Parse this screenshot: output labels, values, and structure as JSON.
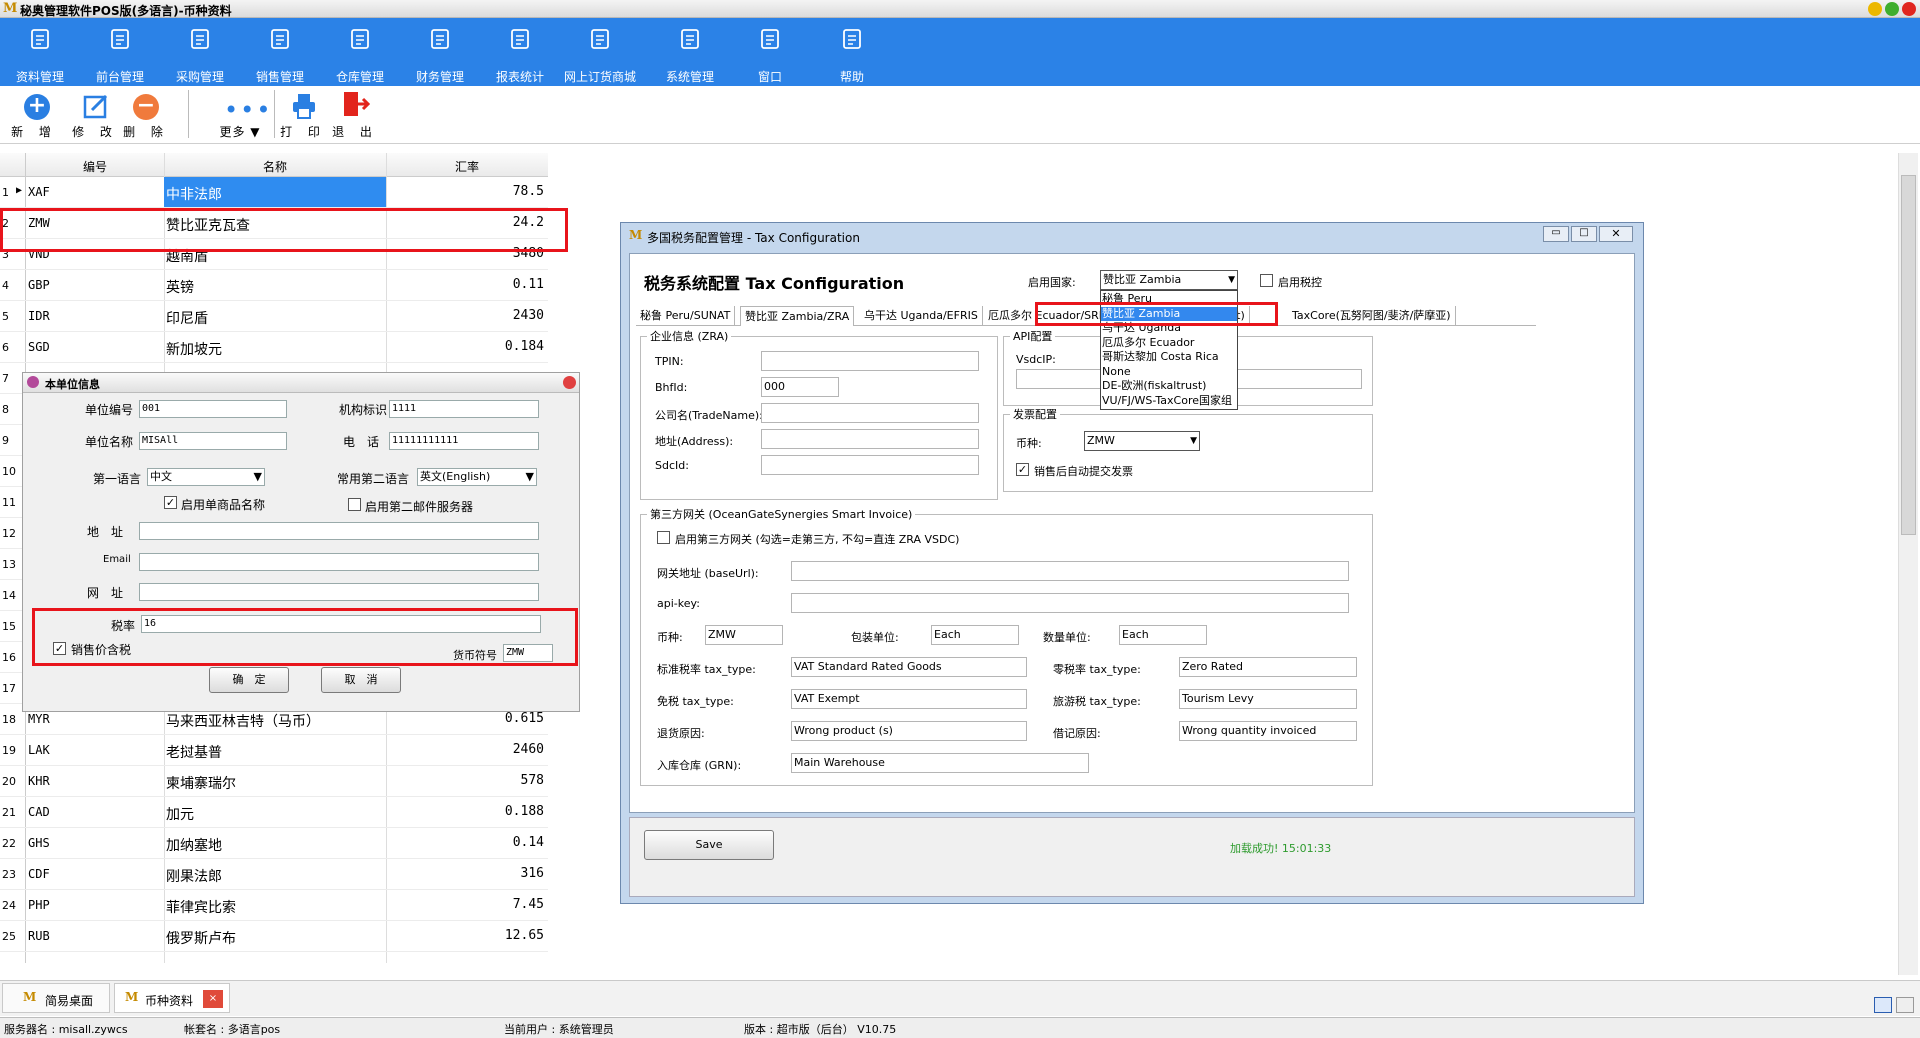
{
  "window": {
    "title": "秘奥管理软件POS版(多语言)-币种资料",
    "logo": "M"
  },
  "menu": [
    {
      "label": "资料管理"
    },
    {
      "label": "前台管理"
    },
    {
      "label": "采购管理"
    },
    {
      "label": "销售管理"
    },
    {
      "label": "仓库管理"
    },
    {
      "label": "财务管理"
    },
    {
      "label": "报表统计"
    },
    {
      "label": "网上订货商城"
    },
    {
      "label": "系统管理"
    },
    {
      "label": "窗口"
    },
    {
      "label": "帮助"
    }
  ],
  "toolbar": {
    "add": "新 增",
    "edit": "修 改",
    "del": "删 除",
    "more": "更多 ▼",
    "print": "打 印",
    "exit": "退 出"
  },
  "grid": {
    "headers": [
      "编号",
      "名称",
      "汇率"
    ],
    "rows": [
      [
        "1",
        "XAF",
        "中非法郎",
        "78.5"
      ],
      [
        "2",
        "ZMW",
        "赞比亚克瓦查",
        "24.2"
      ],
      [
        "3",
        "VND",
        "越南盾",
        "3480"
      ],
      [
        "4",
        "GBP",
        "英镑",
        "0.11"
      ],
      [
        "5",
        "IDR",
        "印尼盾",
        "2430"
      ],
      [
        "6",
        "SGD",
        "新加坡元",
        "0.184"
      ],
      [
        "7",
        "",
        "",
        ""
      ],
      [
        "8",
        "",
        "",
        ""
      ],
      [
        "9",
        "",
        "",
        ""
      ],
      [
        "10",
        "",
        "",
        ""
      ],
      [
        "11",
        "",
        "",
        ""
      ],
      [
        "12",
        "",
        "",
        ""
      ],
      [
        "13",
        "",
        "",
        ""
      ],
      [
        "14",
        "",
        "",
        ""
      ],
      [
        "15",
        "",
        "",
        ""
      ],
      [
        "16",
        "",
        "",
        ""
      ],
      [
        "17",
        "",
        "",
        ""
      ],
      [
        "18",
        "MYR",
        "马来西亚林吉特（马币）",
        "0.615"
      ],
      [
        "19",
        "LAK",
        "老挝基普",
        "2460"
      ],
      [
        "20",
        "KHR",
        "柬埔寨瑞尔",
        "578"
      ],
      [
        "21",
        "CAD",
        "加元",
        "0.188"
      ],
      [
        "22",
        "GHS",
        "加纳塞地",
        "0.14"
      ],
      [
        "23",
        "CDF",
        "刚果法郎",
        "316"
      ],
      [
        "24",
        "PHP",
        "菲律宾比索",
        "7.45"
      ],
      [
        "25",
        "RUB",
        "俄罗斯卢布",
        "12.65"
      ]
    ]
  },
  "unit": {
    "title": "本单位信息",
    "unit_code_label": "单位编号",
    "unit_code": "001",
    "org_label": "机构标识",
    "org": "1111",
    "unit_name_label": "单位名称",
    "unit_name": "MISAll",
    "phone_label": "电　话",
    "phone": "11111111111",
    "lang1_label": "第一语言",
    "lang1": "中文",
    "lang2_label": "常用第二语言",
    "lang2": "英文(English)",
    "chk_single_name": "启用单商品名称",
    "chk_mail2": "启用第二邮件服务器",
    "addr_label": "地　址",
    "email_label": "Email",
    "web_label": "网　址",
    "tax_label": "税率",
    "tax": "16",
    "price_tax": "销售价含税",
    "cur_sym_label": "货币符号",
    "cur_sym": "ZMW",
    "ok": "确　定",
    "cancel": "取　消"
  },
  "tax": {
    "title": "多国税务配置管理 - Tax Configuration",
    "heading": "税务系统配置 Tax Configuration",
    "country_label": "启用国家:",
    "country": "赞比亚 Zambia",
    "enable_tax": "启用税控",
    "tabs": [
      "秘鲁 Peru/SUNAT",
      "赞比亚 Zambia/ZRA",
      "乌干达 Uganda/EFRIS",
      "厄瓜多尔 Ecuador/SRI",
      "德国/欧洲(fiskaltrust)",
      "TaxCore(瓦努阿图/斐济/萨摩亚)"
    ],
    "dropdown": [
      "秘鲁 Peru",
      "赞比亚 Zambia",
      "乌干达 Uganda",
      "厄瓜多尔 Ecuador",
      "哥斯达黎加 Costa Rica",
      "None",
      "DE-欧洲(fiskaltrust)",
      "VU/FJ/WS-TaxCore国家组"
    ],
    "company": {
      "legend": "企业信息 (ZRA)",
      "tpin": "TPIN:",
      "bhfid": "BhfId:",
      "bhfid_val": "000",
      "trade": "公司名(TradeName):",
      "addr": "地址(Address):",
      "sdcid": "SdcId:"
    },
    "api": {
      "legend": "API配置",
      "vsdc": "VsdcIP:"
    },
    "invoice": {
      "legend": "发票配置",
      "currency_label": "币种:",
      "currency": "ZMW",
      "auto_submit": "销售后自动提交发票"
    },
    "gateway": {
      "legend": "第三方网关 (OceanGateSynergies Smart Invoice)",
      "enable": "启用第三方网关 (勾选=走第三方, 不勾=直连 ZRA VSDC)",
      "baseurl": "网关地址 (baseUrl):",
      "apikey": "api-key:",
      "cur_label": "币种:",
      "cur": "ZMW",
      "pack_label": "包装单位:",
      "pack": "Each",
      "qty_label": "数量单位:",
      "qty": "Each",
      "std_label": "标准税率 tax_type:",
      "std": "VAT Standard Rated Goods",
      "zero_label": "零税率 tax_type:",
      "zero": "Zero Rated",
      "exempt_label": "免税 tax_type:",
      "exempt": "VAT Exempt",
      "tour_label": "旅游税 tax_type:",
      "tour": "Tourism Levy",
      "return_label": "退货原因:",
      "return": "Wrong product (s)",
      "debit_label": "借记原因:",
      "debit": "Wrong quantity invoiced",
      "wh_label": "入库仓库 (GRN):",
      "wh": "Main Warehouse"
    },
    "save": "Save",
    "status": "加载成功! 15:01:33"
  },
  "taskbar": [
    {
      "label": "简易桌面"
    },
    {
      "label": "币种资料"
    }
  ],
  "status": {
    "server": "服务器名 : misall.zywcs",
    "account": "帐套名 : 多语言pos",
    "user": "当前用户 : 系统管理员",
    "version": "版本 : 超市版（后台） V10.75"
  }
}
